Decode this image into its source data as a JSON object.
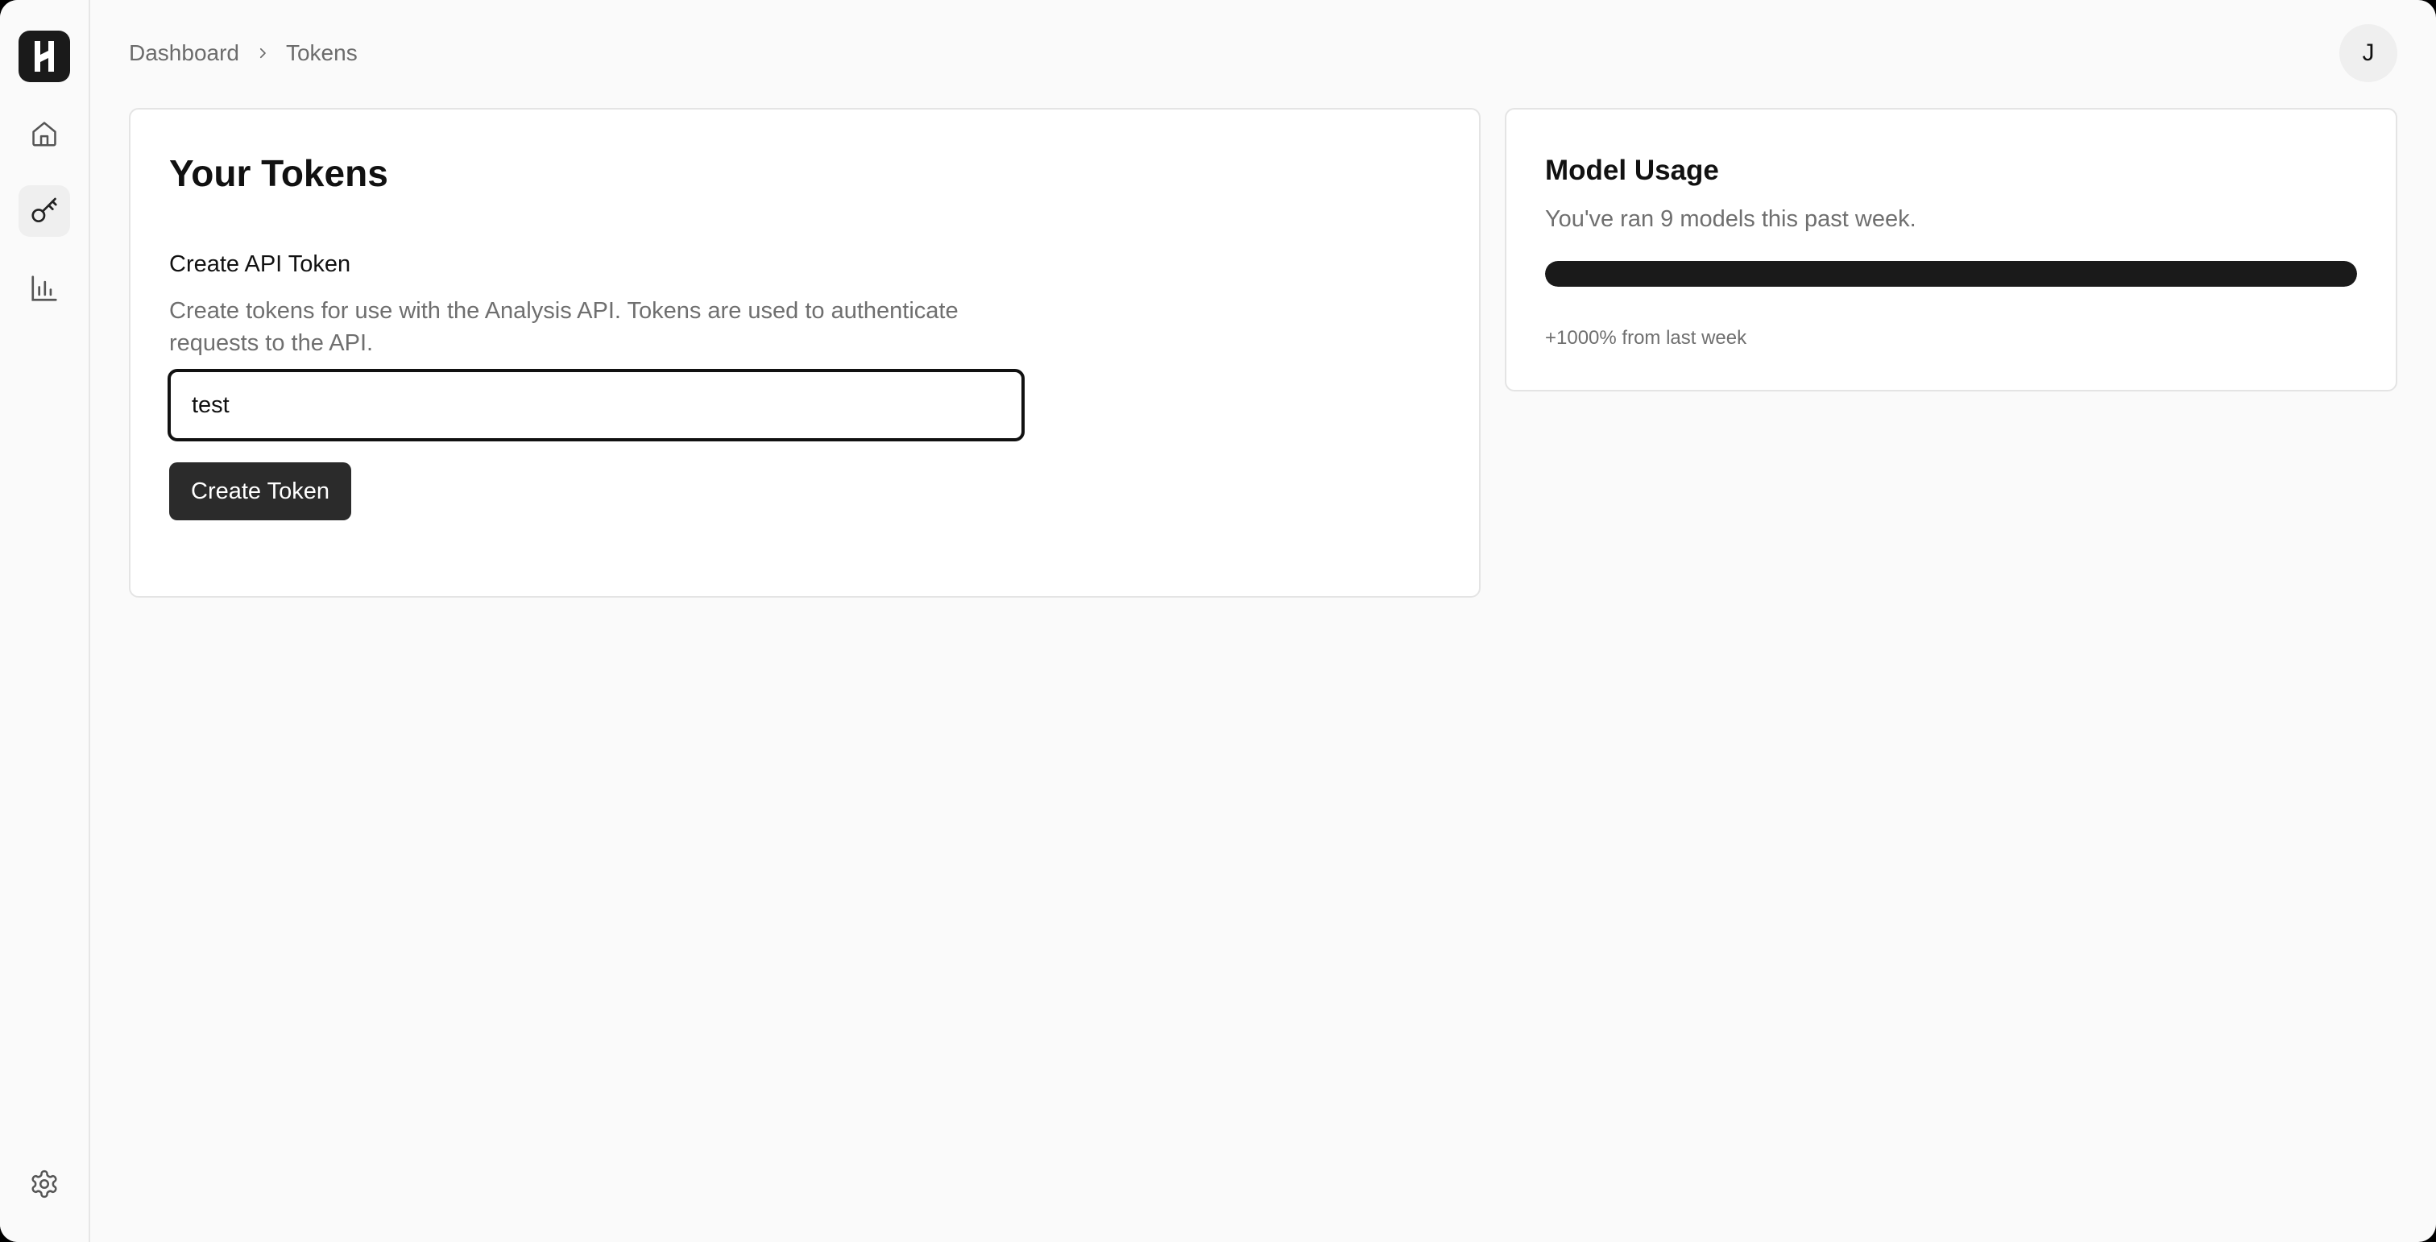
{
  "breadcrumb": {
    "items": [
      "Dashboard",
      "Tokens"
    ]
  },
  "user": {
    "avatar_initial": "J"
  },
  "tokens_card": {
    "title": "Your Tokens",
    "section_label": "Create API Token",
    "description": "Create tokens for use with the Analysis API. Tokens are used to authenticate requests to the API.",
    "input_value": "test",
    "create_button_label": "Create Token"
  },
  "usage_card": {
    "title": "Model Usage",
    "subtitle": "You've ran 9 models this past week.",
    "progress_fraction": 1.0,
    "change_text": "+1000% from last week"
  },
  "sidebar": {
    "items": [
      {
        "icon": "home-icon",
        "active": false
      },
      {
        "icon": "key-icon",
        "active": true
      },
      {
        "icon": "bar-chart-icon",
        "active": false
      },
      {
        "icon": "gear-icon",
        "active": false
      }
    ]
  },
  "colors": {
    "primary": "#1a1a1a",
    "button": "#2b2b2b",
    "muted_text": "#6f6f6f",
    "background": "#fafafa"
  }
}
